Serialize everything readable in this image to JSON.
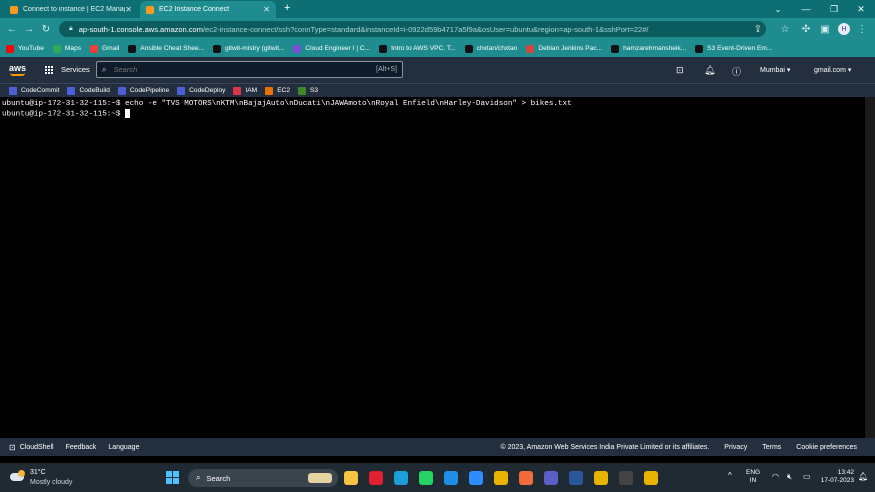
{
  "browser": {
    "tabs": [
      {
        "title": "Connect to instance | EC2 Manag",
        "active": false
      },
      {
        "title": "EC2 Instance Connect",
        "active": true
      }
    ],
    "new_tab": "+",
    "url_host": "ap-south-1.console.aws.amazon.com",
    "url_path": "/ec2-instance-connect/ssh?connType=standard&instanceId=i-0922d59b4717a5f9a&osUser=ubuntu&region=ap-south-1&sshPort=22#/",
    "profile_initial": "H",
    "bookmarks": [
      {
        "label": "YouTube",
        "icon": "youtube-icon",
        "color": "#ff0000"
      },
      {
        "label": "Maps",
        "icon": "maps-icon",
        "color": "#34a853"
      },
      {
        "label": "Gmail",
        "icon": "gmail-icon",
        "color": "#ea4335"
      },
      {
        "label": "Ansible Cheat Shee...",
        "icon": "medium-icon",
        "color": "#111111"
      },
      {
        "label": "gitwit-mistry (gitwit...",
        "icon": "github-icon",
        "color": "#111111"
      },
      {
        "label": "Cloud Engineer I | C...",
        "icon": "bookmark-icon",
        "color": "#7b4fd6"
      },
      {
        "label": "Intro to AWS VPC. T...",
        "icon": "medium-icon",
        "color": "#111111"
      },
      {
        "label": "chxtan/chxtan",
        "icon": "github-icon",
        "color": "#111111"
      },
      {
        "label": "Debian Jenkins Pac...",
        "icon": "jenkins-icon",
        "color": "#d24939"
      },
      {
        "label": "hamzarehmansheik...",
        "icon": "github-icon",
        "color": "#111111"
      },
      {
        "label": "S3 Event-Driven Em...",
        "icon": "medium-icon",
        "color": "#111111"
      }
    ]
  },
  "aws": {
    "logo": "aws",
    "services_label": "Services",
    "search_placeholder": "Search",
    "search_shortcut": "[Alt+S]",
    "region": "Mumbai",
    "account": "gmail.com",
    "favorites": [
      {
        "label": "CodeCommit",
        "color": "#4d5fd6"
      },
      {
        "label": "CodeBuild",
        "color": "#4d5fd6"
      },
      {
        "label": "CodePipeline",
        "color": "#4d5fd6"
      },
      {
        "label": "CodeDeploy",
        "color": "#4d5fd6"
      },
      {
        "label": "IAM",
        "color": "#dd344c"
      },
      {
        "label": "EC2",
        "color": "#ed7100"
      },
      {
        "label": "S3",
        "color": "#3f8624"
      }
    ]
  },
  "terminal": {
    "lines": [
      "ubuntu@ip-172-31-32-115:~$ echo -e \"TVS MOTORS\\nKTM\\nBajajAuto\\nDucati\\nJAWAmoto\\nRoyal Enfield\\nHarley-Davidson\" > bikes.txt",
      "ubuntu@ip-172-31-32-115:~$ "
    ]
  },
  "footer": {
    "cloudshell": "CloudShell",
    "feedback": "Feedback",
    "language": "Language",
    "copyright": "© 2023, Amazon Web Services India Private Limited or its affiliates.",
    "privacy": "Privacy",
    "terms": "Terms",
    "cookies": "Cookie preferences"
  },
  "taskbar": {
    "temperature": "31°C",
    "weather": "Mostly cloudy",
    "search_label": "Search",
    "lang_top": "ENG",
    "lang_bottom": "IN",
    "time": "13:42",
    "date": "17-07-2023",
    "app_icons": [
      {
        "name": "file-explorer-icon",
        "color": "#f6c343"
      },
      {
        "name": "opera-icon",
        "color": "#e0202f"
      },
      {
        "name": "edge-icon",
        "color": "#1c9ed8"
      },
      {
        "name": "whatsapp-icon",
        "color": "#25d366"
      },
      {
        "name": "vscode-icon",
        "color": "#1e8ee6"
      },
      {
        "name": "zoom-icon",
        "color": "#2d8cff"
      },
      {
        "name": "chrome-icon",
        "color": "#e8b400"
      },
      {
        "name": "postman-icon",
        "color": "#f26b3a"
      },
      {
        "name": "teams-icon",
        "color": "#5b5fc7"
      },
      {
        "name": "word-icon",
        "color": "#2b579a"
      },
      {
        "name": "chrome-profile-icon",
        "color": "#e8b400"
      },
      {
        "name": "terminal-icon",
        "color": "#444444"
      },
      {
        "name": "chrome-active-icon",
        "color": "#e8b400"
      }
    ]
  }
}
